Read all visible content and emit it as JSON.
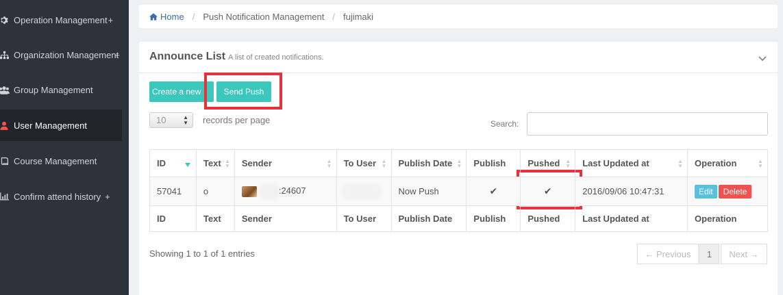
{
  "sidebar": {
    "items": [
      {
        "label": "Operation Management",
        "icon": "gear-icon",
        "has_plus": true
      },
      {
        "label": "Organization Management",
        "icon": "sitemap-icon",
        "has_plus": true
      },
      {
        "label": "Group Management",
        "icon": "users-icon",
        "has_plus": false
      },
      {
        "label": "User Management",
        "icon": "user-icon",
        "has_plus": false,
        "active": true
      },
      {
        "label": "Course Management",
        "icon": "book-icon",
        "has_plus": false
      },
      {
        "label": "Confirm attend history",
        "icon": "bar-chart-icon",
        "has_plus": true
      }
    ],
    "plus": "+"
  },
  "breadcrumb": {
    "home": "Home",
    "section": "Push Notification Management",
    "current": "fujimaki",
    "separator": "/"
  },
  "panel": {
    "title": "Announce List",
    "subtitle": "A list of created notifications."
  },
  "toolbar": {
    "create_label": "Create a new",
    "send_push_label": "Send Push"
  },
  "controls": {
    "page_size": "10",
    "records_label": "records per page",
    "search_label": "Search:",
    "search_value": ""
  },
  "table": {
    "columns": [
      "ID",
      "Text",
      "Sender",
      "To User",
      "Publish Date",
      "Publish",
      "Pushed",
      "Last Updated at",
      "Operation"
    ],
    "rows": [
      {
        "id": "57041",
        "text": "o",
        "sender_suffix": ":24607",
        "to_user": "",
        "publish_date": "Now Push",
        "publish": "✔",
        "pushed": "✔",
        "last_updated": "2016/09/06 10:47:31",
        "edit_label": "Edit",
        "delete_label": "Delete"
      }
    ]
  },
  "footer": {
    "showing": "Showing 1 to 1 of 1 entries",
    "previous": "← Previous",
    "page": "1",
    "next": "Next →"
  },
  "colors": {
    "sidebar_bg": "#2c333b",
    "accent_teal": "#3cc7bc",
    "highlight_red": "#e8323b",
    "edit_blue": "#5bc0de",
    "delete_red": "#ef5350"
  }
}
